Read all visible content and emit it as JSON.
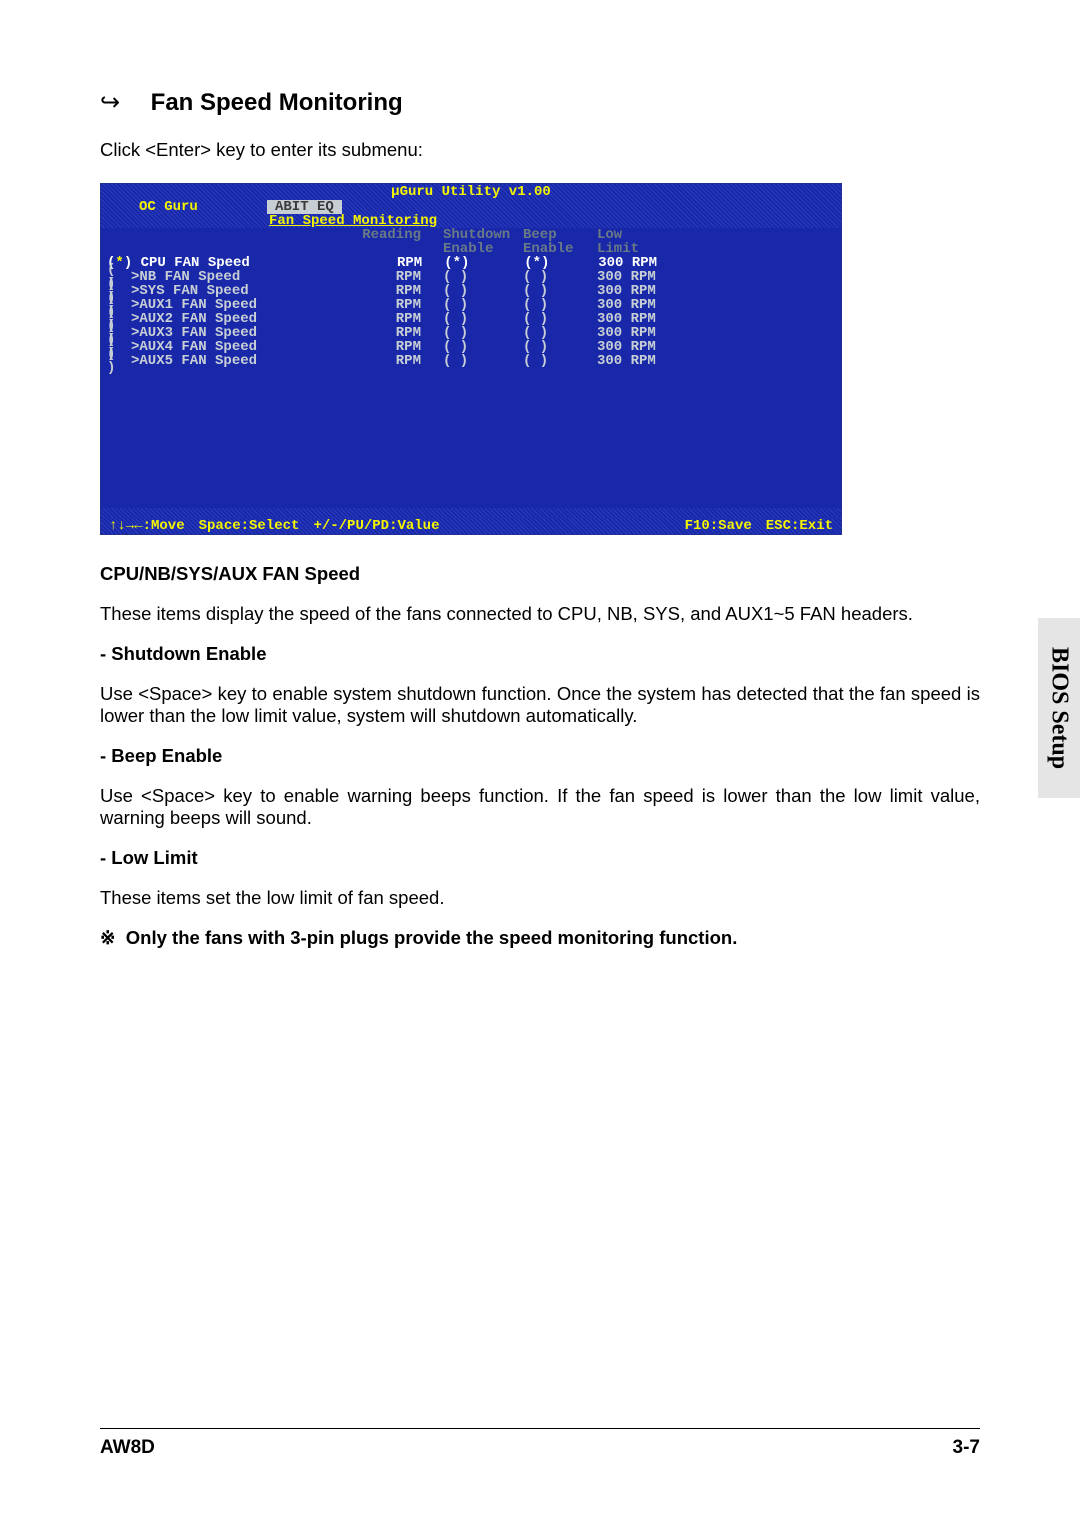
{
  "heading": {
    "arrow_glyph": "↪",
    "title": "Fan Speed Monitoring"
  },
  "intro": "Click <Enter> key to enter its submenu:",
  "bios": {
    "title": "µGuru Utility v1.00",
    "tab_inactive": "OC Guru",
    "tab_active": "ABIT EQ",
    "subtitle": "Fan Speed Monitoring",
    "headers": {
      "reading": "Reading",
      "shutdown1": "Shutdown",
      "shutdown2": "Enable",
      "beep1": "Beep",
      "beep2": "Enable",
      "low1": "Low",
      "low2": "Limit"
    },
    "rows": [
      {
        "mark": "( )",
        "arrow": "",
        "name": "CPU FAN Speed",
        "reading": "RPM",
        "shut": "(*)",
        "beep": "(*)",
        "limit": "300 RPM",
        "highlight": true,
        "sel_mark": "(*)"
      },
      {
        "mark": "( )",
        "arrow": ">",
        "name": "NB FAN Speed",
        "reading": "RPM",
        "shut": "( )",
        "beep": "( )",
        "limit": "300 RPM"
      },
      {
        "mark": "( )",
        "arrow": ">",
        "name": "SYS FAN Speed",
        "reading": "RPM",
        "shut": "( )",
        "beep": "( )",
        "limit": "300 RPM"
      },
      {
        "mark": "( )",
        "arrow": ">",
        "name": "AUX1 FAN Speed",
        "reading": "RPM",
        "shut": "( )",
        "beep": "( )",
        "limit": "300 RPM"
      },
      {
        "mark": "( )",
        "arrow": ">",
        "name": "AUX2 FAN Speed",
        "reading": "RPM",
        "shut": "( )",
        "beep": "( )",
        "limit": "300 RPM"
      },
      {
        "mark": "( )",
        "arrow": ">",
        "name": "AUX3 FAN Speed",
        "reading": "RPM",
        "shut": "( )",
        "beep": "( )",
        "limit": "300 RPM"
      },
      {
        "mark": "( )",
        "arrow": ">",
        "name": "AUX4 FAN Speed",
        "reading": "RPM",
        "shut": "( )",
        "beep": "( )",
        "limit": "300 RPM"
      },
      {
        "mark": "( )",
        "arrow": ">",
        "name": "AUX5 FAN Speed",
        "reading": "RPM",
        "shut": "( )",
        "beep": "( )",
        "limit": "300 RPM"
      }
    ],
    "footer": {
      "move": "↑↓→←:Move",
      "select": "Space:Select",
      "value": "+/-/PU/PD:Value",
      "save": "F10:Save",
      "exit": "ESC:Exit"
    }
  },
  "desc": {
    "sub1": "CPU/NB/SYS/AUX FAN Speed",
    "p1": "These items display the speed of the fans connected to CPU, NB, SYS, and AUX1~5 FAN headers.",
    "b1": "-   Shutdown Enable",
    "p2": "Use <Space> key to enable system shutdown function. Once the system has detected that the fan speed is lower than the low limit value, system will shutdown automatically.",
    "b2": "-   Beep Enable",
    "p3": "Use <Space> key to enable warning beeps function. If the fan speed is lower than the low limit value, warning beeps will sound.",
    "b3": "-   Low Limit",
    "p4": "These items set the low limit of fan speed.",
    "note_glyph": "※",
    "note": "Only the fans with 3-pin plugs provide the speed monitoring function."
  },
  "side_tab": "BIOS Setup",
  "footer": {
    "left": "AW8D",
    "right": "3-7"
  }
}
